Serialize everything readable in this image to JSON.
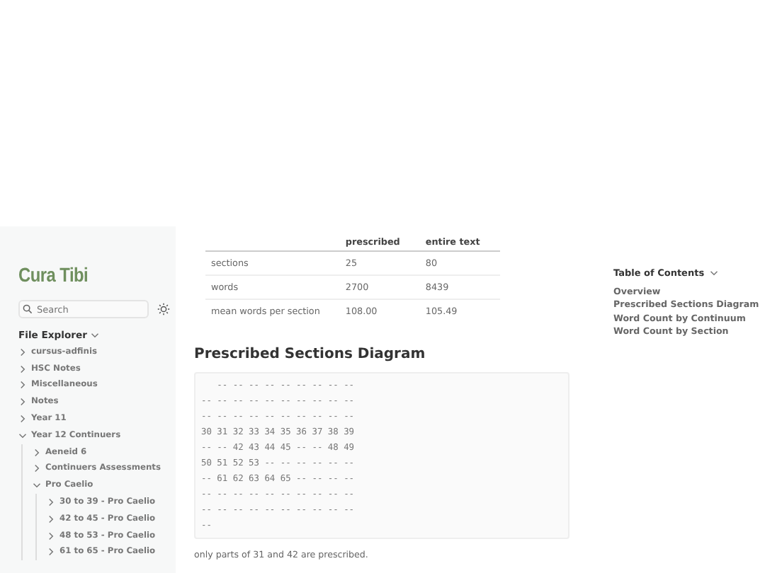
{
  "sidebar": {
    "title": "Cura Tibi",
    "search": {
      "placeholder": "Search"
    },
    "explorer_title": "File Explorer",
    "explorer_expanded": true,
    "tree": [
      {
        "label": "cursus-adfinis",
        "expanded": false
      },
      {
        "label": "HSC Notes",
        "expanded": false
      },
      {
        "label": "Miscellaneous",
        "expanded": false
      },
      {
        "label": "Notes",
        "expanded": false
      },
      {
        "label": "Year 11",
        "expanded": false
      },
      {
        "label": "Year 12 Continuers",
        "expanded": true,
        "children": [
          {
            "label": "Aeneid 6",
            "expanded": false
          },
          {
            "label": "Continuers Assessments",
            "expanded": false
          },
          {
            "label": "Pro Caelio",
            "expanded": true,
            "children": [
              {
                "label": "30 to 39 - Pro Caelio",
                "expanded": false
              },
              {
                "label": "42 to 45 - Pro Caelio",
                "expanded": false
              },
              {
                "label": "48 to 53 - Pro Caelio",
                "expanded": false
              },
              {
                "label": "61 to 65 - Pro Caelio",
                "expanded": false
              }
            ]
          }
        ]
      }
    ]
  },
  "table": {
    "columns": [
      "",
      "prescribed",
      "entire text"
    ],
    "rows": [
      [
        "sections",
        "25",
        "80"
      ],
      [
        "words",
        "2700",
        "8439"
      ],
      [
        "mean words per section",
        "108.00",
        "105.49"
      ]
    ]
  },
  "diagram": {
    "heading": "Prescribed Sections Diagram",
    "text": "   -- -- -- -- -- -- -- -- --\n-- -- -- -- -- -- -- -- -- --\n-- -- -- -- -- -- -- -- -- --\n30 31 32 33 34 35 36 37 38 39\n-- -- 42 43 44 45 -- -- 48 49\n50 51 52 53 -- -- -- -- -- --\n-- 61 62 63 64 65 -- -- -- --\n-- -- -- -- -- -- -- -- -- --\n-- -- -- -- -- -- -- -- -- --\n--"
  },
  "note": "only parts of 31 and 42 are prescribed.",
  "toc": {
    "title": "Table of Contents",
    "expanded": true,
    "items": [
      "Overview",
      "Prescribed Sections Diagram",
      "Word Count by Continuum",
      "Word Count by Section"
    ]
  }
}
